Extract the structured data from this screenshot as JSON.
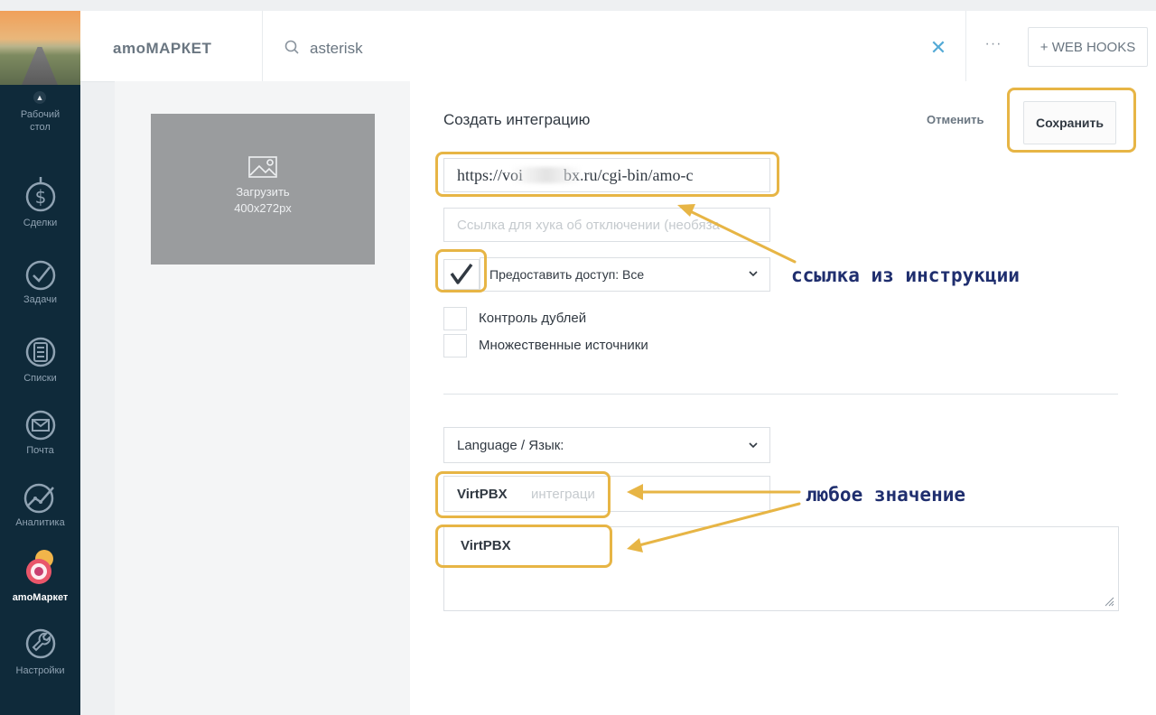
{
  "colors": {
    "sidebar_bg": "#0f2a3a",
    "accent_blue": "#54aad6",
    "annotation_yellow": "#e7b545",
    "annotation_text": "#1f2e6e"
  },
  "sidebar": {
    "items": [
      {
        "label": "Рабочий стол",
        "icon": "dashboard-icon"
      },
      {
        "label": "Сделки",
        "icon": "dollar-icon"
      },
      {
        "label": "Задачи",
        "icon": "check-circle-icon"
      },
      {
        "label": "Списки",
        "icon": "list-icon"
      },
      {
        "label": "Почта",
        "icon": "mail-icon"
      },
      {
        "label": "Аналитика",
        "icon": "analytics-icon"
      },
      {
        "label": "amoМаркет",
        "icon": "amomarket-icon",
        "active": true
      },
      {
        "label": "Настройки",
        "icon": "wrench-icon"
      }
    ]
  },
  "header": {
    "brand": "amoМАРКЕТ",
    "search_value": "asterisk",
    "more_label": "···",
    "webhooks_label": "+ WEB HOOKS"
  },
  "upload": {
    "label": "Загрузить",
    "size": "400x272px"
  },
  "form": {
    "title": "Создать интеграцию",
    "cancel_label": "Отменить",
    "save_label": "Сохранить",
    "hook_url_value": "https://voi          bx.ru/cgi-bin/amo-c",
    "disable_hook_placeholder": "Ссылка для хука об отключении (необяза",
    "access_label": "Предоставить доступ: Все",
    "duplicate_control_label": "Контроль дублей",
    "multi_sources_label": "Множественные источники",
    "language_label": "Language / Язык:",
    "name_value": "VirtPBX",
    "name_placeholder": "интеграци",
    "description_value": "VirtPBX"
  },
  "annotations": {
    "link_note": "ссылка из инструкции",
    "any_value_note": "любое значение"
  }
}
